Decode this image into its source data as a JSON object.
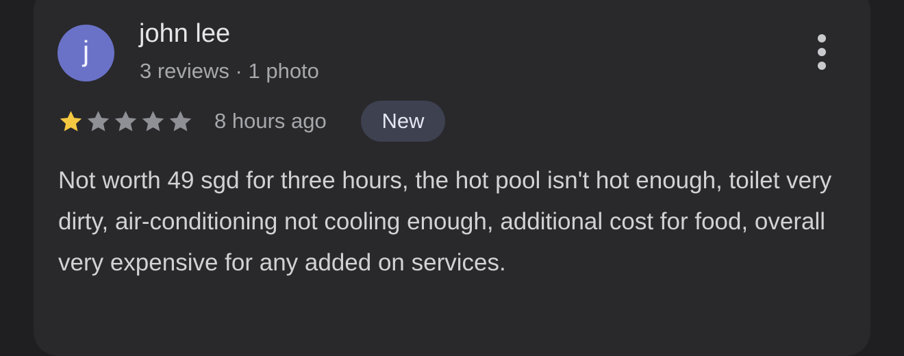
{
  "review": {
    "avatar_initial": "j",
    "reviewer_name": "john lee",
    "reviewer_meta": "3 reviews · 1 photo",
    "rating": 1,
    "rating_max": 5,
    "timestamp": "8 hours ago",
    "badge": "New",
    "text": "Not worth 49 sgd for three hours, the hot pool isn't hot enough, toilet very dirty, air-conditioning not cooling enough, additional cost for food, overall very expensive for any added on services."
  },
  "colors": {
    "star_filled": "#f5c842",
    "star_empty": "#8e9095",
    "avatar_bg": "#6a72c7",
    "badge_bg": "#3d4150"
  },
  "icons": {
    "more": "more-vert-icon",
    "star": "star-icon"
  }
}
